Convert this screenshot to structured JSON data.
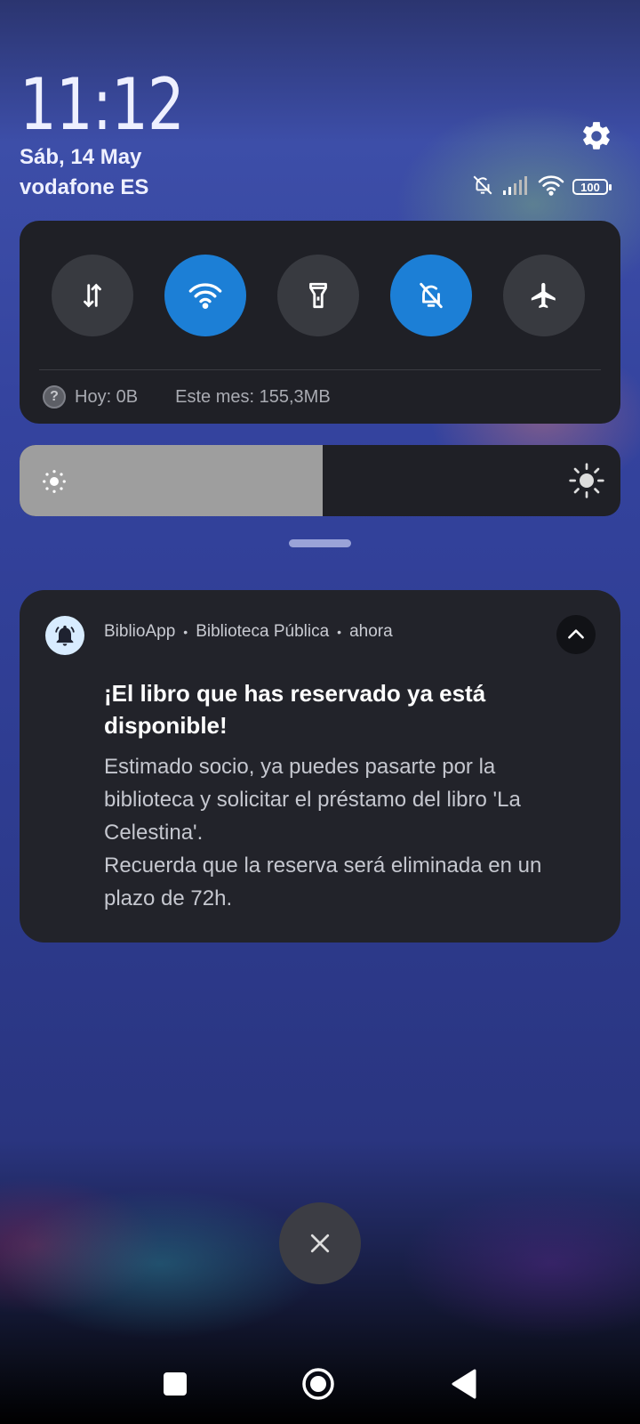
{
  "clock": {
    "time": "11:12",
    "date": "Sáb, 14 May",
    "carrier": "vodafone ES"
  },
  "status": {
    "battery": "100",
    "icons": [
      "bell-muted-icon",
      "signal-icon",
      "wifi-icon",
      "battery-icon"
    ]
  },
  "quick_settings": {
    "tiles": [
      {
        "name": "mobile-data",
        "icon": "data-arrows-icon",
        "active": false
      },
      {
        "name": "wifi",
        "icon": "wifi-icon",
        "active": true
      },
      {
        "name": "flashlight",
        "icon": "flashlight-icon",
        "active": false
      },
      {
        "name": "silent",
        "icon": "bell-muted-icon",
        "active": true
      },
      {
        "name": "airplane",
        "icon": "airplane-icon",
        "active": false
      }
    ],
    "data_usage": {
      "help_glyph": "?",
      "today": "Hoy: 0B",
      "month": "Este mes: 155,3MB"
    },
    "accent": "#1c7fd6"
  },
  "brightness": {
    "level": 0.505
  },
  "notification": {
    "app": "BiblioApp",
    "subtext": "Biblioteca Pública",
    "when": "ahora",
    "separator": "•",
    "title": "¡El libro que has reservado ya está disponible!",
    "body": "Estimado socio, ya puedes pasarte por la biblioteca y solicitar el préstamo del libro 'La Celestina'.\nRecuerda que la reserva será eliminada en un plazo de 72h."
  },
  "navigation": {
    "buttons": [
      "recents",
      "home",
      "back"
    ]
  }
}
